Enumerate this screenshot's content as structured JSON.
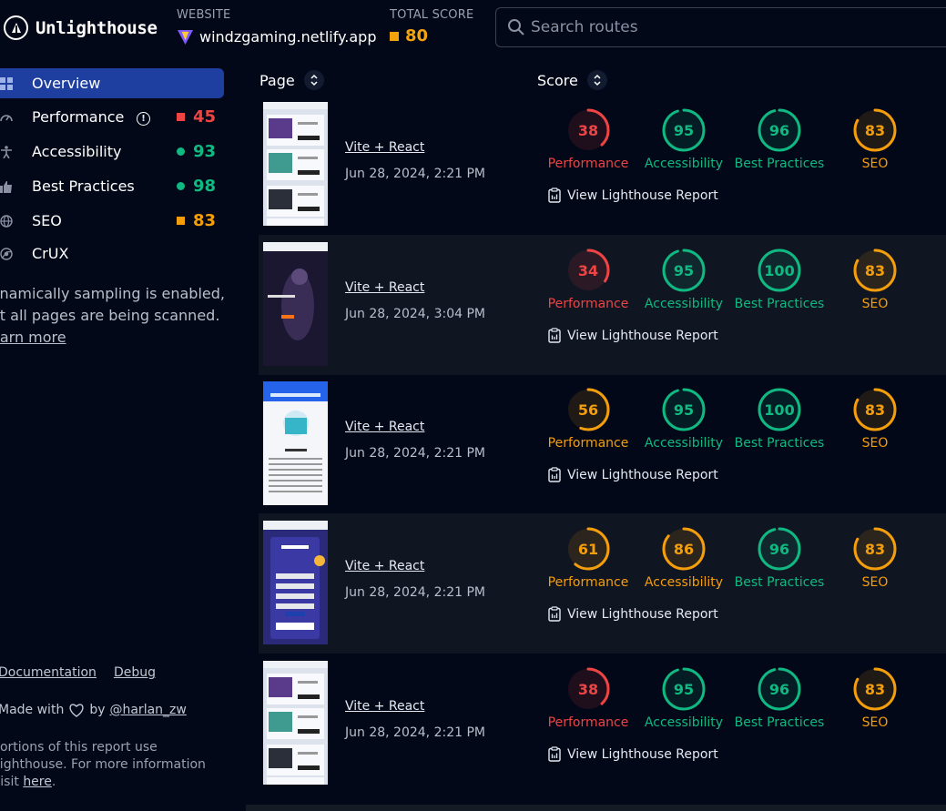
{
  "header": {
    "app_title": "Unlighthouse",
    "website_label": "WEBSITE",
    "website_value": "windzgaming.netlify.app",
    "total_score_label": "TOTAL SCORE",
    "total_score_value": "80",
    "search_placeholder": "Search routes"
  },
  "sidebar": {
    "items": [
      {
        "label": "Overview",
        "icon": "grid-icon",
        "active": true
      },
      {
        "label": "Performance",
        "icon": "gauge-icon",
        "score": "45",
        "marker": "square",
        "color": "#ef4444",
        "info": "!"
      },
      {
        "label": "Accessibility",
        "icon": "person-icon",
        "score": "93",
        "marker": "dot",
        "color": "#10b981"
      },
      {
        "label": "Best Practices",
        "icon": "thumbs-up-icon",
        "score": "98",
        "marker": "dot",
        "color": "#10b981"
      },
      {
        "label": "SEO",
        "icon": "globe-icon",
        "score": "83",
        "marker": "square",
        "color": "#f59e0b"
      },
      {
        "label": "CrUX",
        "icon": "chrome-icon"
      }
    ],
    "notice_text": "ynamically sampling is enabled,\not all pages are being scanned.",
    "notice_link": "earn more"
  },
  "footer": {
    "documentation": "Documentation",
    "debug": "Debug",
    "made_with": "Made with",
    "by": "by",
    "author": "@harlan_zw",
    "portions_text": "Portions of this report use Lighthouse. For more information visit",
    "portions_link": "here",
    "portions_end": "."
  },
  "table": {
    "page_header": "Page",
    "score_header": "Score",
    "view_report_label": "View Lighthouse Report",
    "rows": [
      {
        "route": "Vite + React",
        "date": "Jun 28, 2024, 2:21 PM",
        "thumb": "products",
        "scores": [
          {
            "label": "Performance",
            "value": "38"
          },
          {
            "label": "Accessibility",
            "value": "95"
          },
          {
            "label": "Best Practices",
            "value": "96"
          },
          {
            "label": "SEO",
            "value": "83"
          }
        ]
      },
      {
        "route": "Vite + React",
        "date": "Jun 28, 2024, 3:04 PM",
        "thumb": "hero",
        "scores": [
          {
            "label": "Performance",
            "value": "34"
          },
          {
            "label": "Accessibility",
            "value": "95"
          },
          {
            "label": "Best Practices",
            "value": "100"
          },
          {
            "label": "SEO",
            "value": "83"
          }
        ]
      },
      {
        "route": "Vite + React",
        "date": "Jun 28, 2024, 2:21 PM",
        "thumb": "about",
        "scores": [
          {
            "label": "Performance",
            "value": "56"
          },
          {
            "label": "Accessibility",
            "value": "95"
          },
          {
            "label": "Best Practices",
            "value": "100"
          },
          {
            "label": "SEO",
            "value": "83"
          }
        ]
      },
      {
        "route": "Vite + React",
        "date": "Jun 28, 2024, 2:21 PM",
        "thumb": "signup",
        "scores": [
          {
            "label": "Performance",
            "value": "61"
          },
          {
            "label": "Accessibility",
            "value": "86"
          },
          {
            "label": "Best Practices",
            "value": "96"
          },
          {
            "label": "SEO",
            "value": "83"
          }
        ]
      },
      {
        "route": "Vite + React",
        "date": "Jun 28, 2024, 2:21 PM",
        "thumb": "products",
        "scores": [
          {
            "label": "Performance",
            "value": "38"
          },
          {
            "label": "Accessibility",
            "value": "95"
          },
          {
            "label": "Best Practices",
            "value": "96"
          },
          {
            "label": "SEO",
            "value": "83"
          }
        ]
      }
    ]
  },
  "colors": {
    "good": "#10b981",
    "average": "#f59e0b",
    "poor": "#ef4444",
    "active_nav": "#1f3fa0"
  }
}
